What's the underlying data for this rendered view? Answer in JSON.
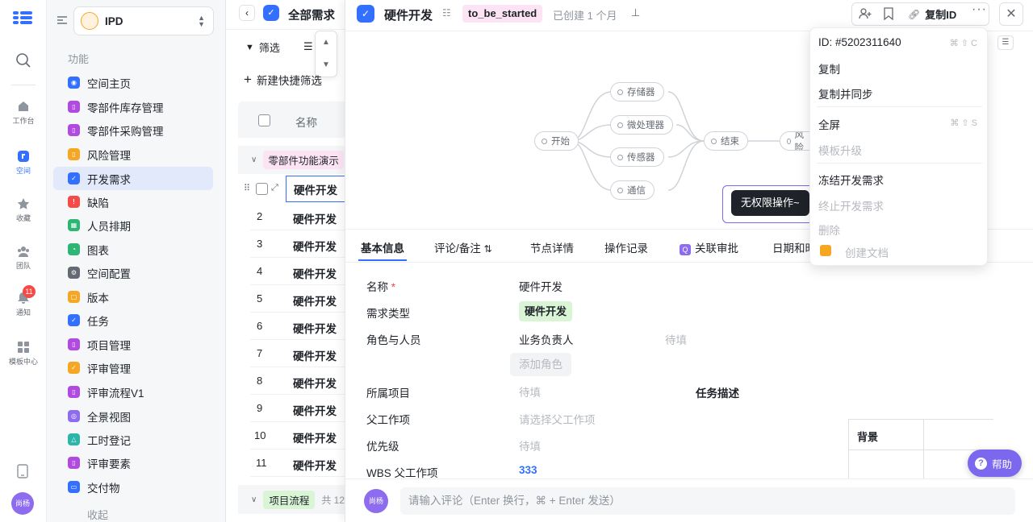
{
  "rail": {
    "items": [
      {
        "label": "工作台",
        "icon": "home-icon"
      },
      {
        "label": "空间",
        "icon": "space-icon"
      },
      {
        "label": "收藏",
        "icon": "star-icon"
      },
      {
        "label": "团队",
        "icon": "team-icon"
      },
      {
        "label": "通知",
        "icon": "bell-icon",
        "badge": "11"
      },
      {
        "label": "模板中心",
        "icon": "template-icon"
      }
    ],
    "avatar": "尚杨"
  },
  "sidebar": {
    "space_name": "IPD",
    "section_label": "功能",
    "collapse_label": "收起",
    "items": [
      {
        "label": "空间主页",
        "color": "#3370ff"
      },
      {
        "label": "零部件库存管理",
        "color": "#b04ae0"
      },
      {
        "label": "零部件采购管理",
        "color": "#b04ae0"
      },
      {
        "label": "风险管理",
        "color": "#f5a623"
      },
      {
        "label": "开发需求",
        "color": "#3370ff"
      },
      {
        "label": "缺陷",
        "color": "#f54a45"
      },
      {
        "label": "人员排期",
        "color": "#2bb673"
      },
      {
        "label": "图表",
        "color": "#2bb673"
      },
      {
        "label": "空间配置",
        "color": "#646a73"
      },
      {
        "label": "版本",
        "color": "#f5a623"
      },
      {
        "label": "任务",
        "color": "#3370ff"
      },
      {
        "label": "项目管理",
        "color": "#b04ae0"
      },
      {
        "label": "评审管理",
        "color": "#f5a623"
      },
      {
        "label": "评审流程V1",
        "color": "#b04ae0"
      },
      {
        "label": "全景视图",
        "color": "#8e6cf0"
      },
      {
        "label": "工时登记",
        "color": "#2bb6a8"
      },
      {
        "label": "评审要素",
        "color": "#b04ae0"
      },
      {
        "label": "交付物",
        "color": "#3370ff"
      }
    ]
  },
  "list": {
    "view_title": "全部需求",
    "filter_label": "筛选",
    "quick_filter_label": "新建快捷筛选",
    "name_header": "名称",
    "group1_label": "零部件功能演示",
    "group2_label": "项目流程",
    "group2_count": "共 12",
    "rows": [
      {
        "num": "",
        "name": "硬件开发"
      },
      {
        "num": "2",
        "name": "硬件开发"
      },
      {
        "num": "3",
        "name": "硬件开发"
      },
      {
        "num": "4",
        "name": "硬件开发"
      },
      {
        "num": "5",
        "name": "硬件开发"
      },
      {
        "num": "6",
        "name": "硬件开发"
      },
      {
        "num": "7",
        "name": "硬件开发"
      },
      {
        "num": "8",
        "name": "硬件开发"
      },
      {
        "num": "9",
        "name": "硬件开发"
      },
      {
        "num": "10",
        "name": "硬件开发"
      },
      {
        "num": "11",
        "name": "硬件开发"
      }
    ]
  },
  "detail": {
    "title": "硬件开发",
    "status": "to_be_started",
    "created": "已创建 1 个月",
    "copy_id_label": "复制ID",
    "mindmap": {
      "start": "开始",
      "branches": [
        "存储器",
        "微处理器",
        "传感器",
        "通信"
      ],
      "end": "结束",
      "next": "风险"
    },
    "tooltip": "无权限操作~",
    "tabs": [
      "基本信息",
      "评论/备注",
      "节点详情",
      "操作记录",
      "关联审批",
      "日期和时"
    ],
    "fields": {
      "name_label": "名称",
      "name_value": "硬件开发",
      "type_label": "需求类型",
      "type_value": "硬件开发",
      "role_label": "角色与人员",
      "role_value": "业务负责人",
      "role_placeholder": "待填",
      "add_role_label": "添加角色",
      "project_label": "所属项目",
      "project_placeholder": "待填",
      "task_desc_label": "任务描述",
      "parent_label": "父工作项",
      "parent_placeholder": "请选择父工作项",
      "priority_label": "优先级",
      "priority_placeholder": "待填",
      "wbs_label": "WBS 父工作项",
      "wbs_value": "333",
      "bg_label": "背景"
    },
    "comment_placeholder": "请输入评论（Enter 换行，⌘ + Enter 发送）",
    "comment_avatar": "尚杨",
    "help_label": "帮助"
  },
  "menu": {
    "id_label": "ID: #5202311640",
    "id_shortcut": "⌘ ⇧ C",
    "copy": "复制",
    "copy_sync": "复制并同步",
    "fullscreen": "全屏",
    "fullscreen_shortcut": "⌘ ⇧ S",
    "upgrade": "模板升级",
    "freeze": "冻结开发需求",
    "terminate": "终止开发需求",
    "delete": "删除",
    "create_doc": "创建文档"
  }
}
